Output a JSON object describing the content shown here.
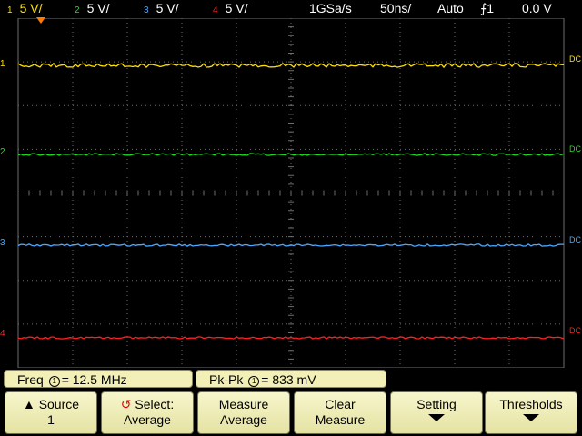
{
  "top_bar": {
    "channels": [
      {
        "num": "1",
        "scale": "5 V/",
        "color": "#ffe000"
      },
      {
        "num": "2",
        "scale": "5 V/",
        "color": "#22dd22"
      },
      {
        "num": "3",
        "scale": "5 V/",
        "color": "#4aa8ff"
      },
      {
        "num": "4",
        "scale": "5 V/",
        "color": "#ff2020"
      }
    ],
    "sample_rate": "1GSa/s",
    "timebase": "50ns/",
    "trigger_mode": "Auto",
    "trigger_source": "1",
    "trigger_level": "0.0 V"
  },
  "markers": {
    "channel_labels": [
      "1",
      "2",
      "3",
      "4"
    ],
    "coupling": "DC"
  },
  "measurements": [
    {
      "name": "Freq",
      "source": "1",
      "value": "12.5 MHz"
    },
    {
      "name": "Pk-Pk",
      "source": "1",
      "value": "833 mV"
    }
  ],
  "softkeys": [
    {
      "line1": "Source",
      "line2": "1",
      "icon": "up-arrow-icon"
    },
    {
      "line1": "Select:",
      "line2": "Average",
      "icon": "rotary-knob-icon"
    },
    {
      "line1": "Measure",
      "line2": "Average"
    },
    {
      "line1": "Clear",
      "line2": "Measure"
    },
    {
      "line1": "Setting",
      "line2": "",
      "icon": "down-arrow-icon"
    },
    {
      "line1": "Thresholds",
      "line2": "",
      "icon": "down-arrow-icon"
    }
  ],
  "colors": {
    "grid": "#6e6e6e",
    "softkey_bg": "#f2f0b6",
    "trigger_marker": "#ff7a00"
  }
}
